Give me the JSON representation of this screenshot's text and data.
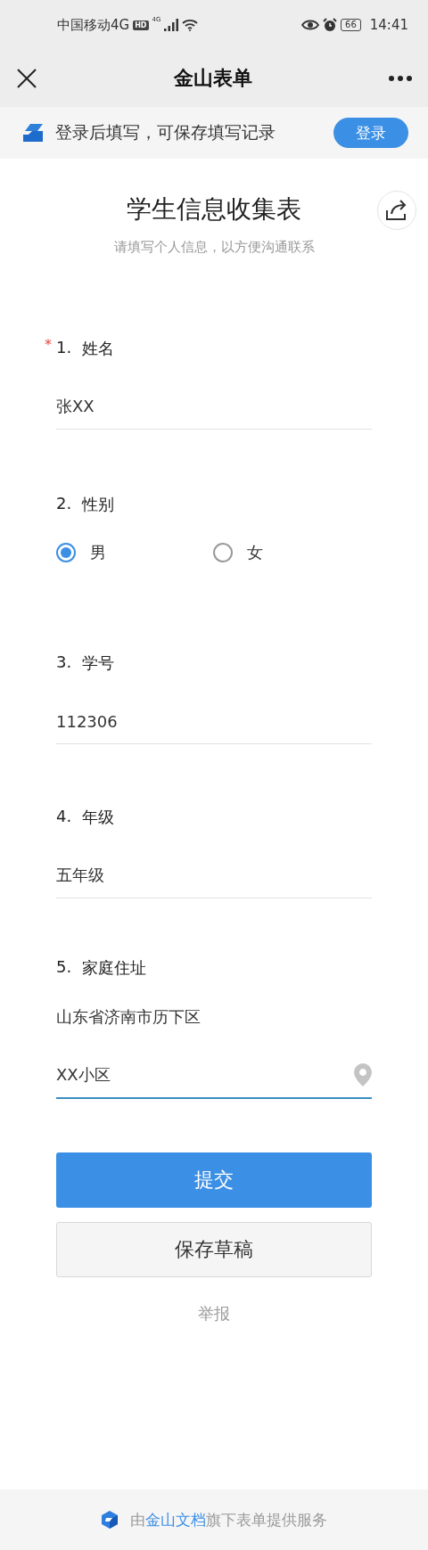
{
  "status_bar": {
    "carrier": "中国移动4G",
    "hd_badge": "HD",
    "network": "4G",
    "battery": "66",
    "time": "14:41"
  },
  "nav": {
    "title": "金山表单"
  },
  "login_banner": {
    "text": "登录后填写，可保存填写记录",
    "button": "登录"
  },
  "form": {
    "title": "学生信息收集表",
    "subtitle": "请填写个人信息，以方便沟通联系",
    "questions": [
      {
        "kind": "text",
        "number": "1.",
        "label": "姓名",
        "required_mark": "*",
        "value": "张XX",
        "focused": false
      },
      {
        "kind": "radio",
        "number": "2.",
        "label": "性别",
        "options": [
          {
            "label": "男",
            "selected": true
          },
          {
            "label": "女",
            "selected": false
          }
        ]
      },
      {
        "kind": "text",
        "number": "3.",
        "label": "学号",
        "value": "112306",
        "focused": false
      },
      {
        "kind": "text",
        "number": "4.",
        "label": "年级",
        "value": "五年级",
        "focused": false
      },
      {
        "kind": "address",
        "number": "5.",
        "label": "家庭住址",
        "region": "山东省济南市历下区",
        "value": "XX小区",
        "focused": true
      }
    ]
  },
  "buttons": {
    "submit": "提交",
    "draft": "保存草稿",
    "report": "举报"
  },
  "footer": {
    "prefix": "由",
    "brand": "金山文档",
    "suffix": "旗下表单提供服务"
  }
}
